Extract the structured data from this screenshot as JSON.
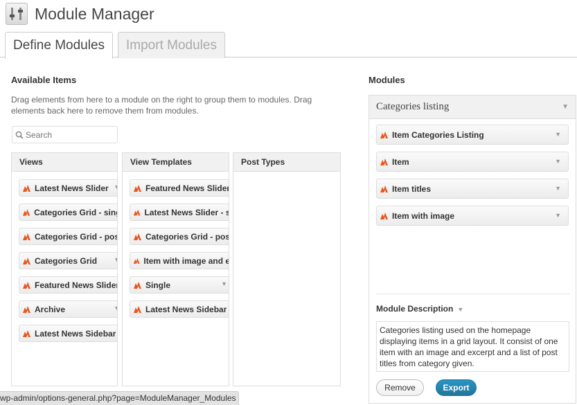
{
  "header": {
    "title": "Module Manager"
  },
  "tabs": [
    {
      "label": "Define Modules",
      "active": true
    },
    {
      "label": "Import Modules",
      "active": false
    }
  ],
  "available": {
    "title": "Available Items",
    "help": "Drag elements from here to a module on the right to group them to modules. Drag elements back here to remove them from modules.",
    "search_placeholder": "Search"
  },
  "columns": [
    {
      "title": "Views",
      "items": [
        "Latest News Slider",
        "Categories Grid - single",
        "Categories Grid - post",
        "Categories Grid",
        "Featured News Slider",
        "Archive",
        "Latest News Sidebar"
      ]
    },
    {
      "title": "View Templates",
      "items": [
        "Featured News Slider",
        "Latest News Slider - slide",
        "Categories Grid - post",
        "Item with image and excerpt",
        "Single",
        "Latest News Sidebar"
      ]
    },
    {
      "title": "Post Types",
      "items": []
    }
  ],
  "modules": {
    "title": "Modules",
    "selected": "Categories listing",
    "items": [
      "Item Categories Listing",
      "Item",
      "Item titles",
      "Item with image"
    ],
    "description_label": "Module Description",
    "description": "Categories listing used on the homepage displaying items in a grid layout. It consist of one item with an image and excerpt and a list of post titles from category given.",
    "remove_label": "Remove",
    "export_label": "Export"
  },
  "status_bar": {
    "text": "wp-admin/options-general.php?page=ModuleManager_Modules"
  },
  "colors": {
    "accent": "#21759b",
    "item_icon": "#e8561f"
  }
}
